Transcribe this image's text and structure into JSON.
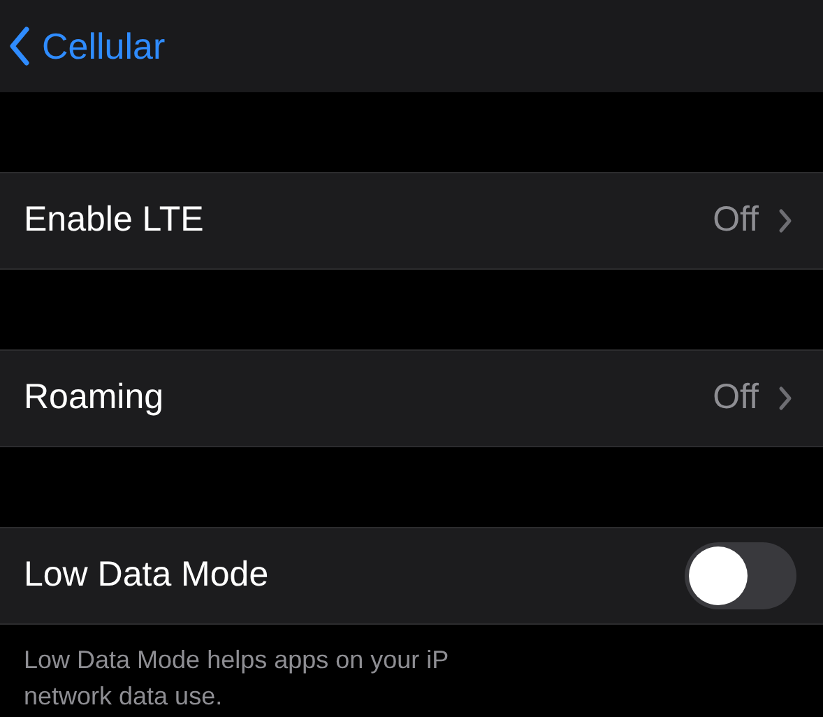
{
  "nav": {
    "back_label": "Cellular"
  },
  "rows": [
    {
      "kind": "disclosure",
      "label": "Enable LTE",
      "value": "Off"
    },
    {
      "kind": "disclosure",
      "label": "Roaming",
      "value": "Off"
    },
    {
      "kind": "toggle",
      "label": "Low Data Mode",
      "on": false
    }
  ],
  "footer": [
    "Low Data Mode helps apps on your iP",
    "network data use."
  ]
}
